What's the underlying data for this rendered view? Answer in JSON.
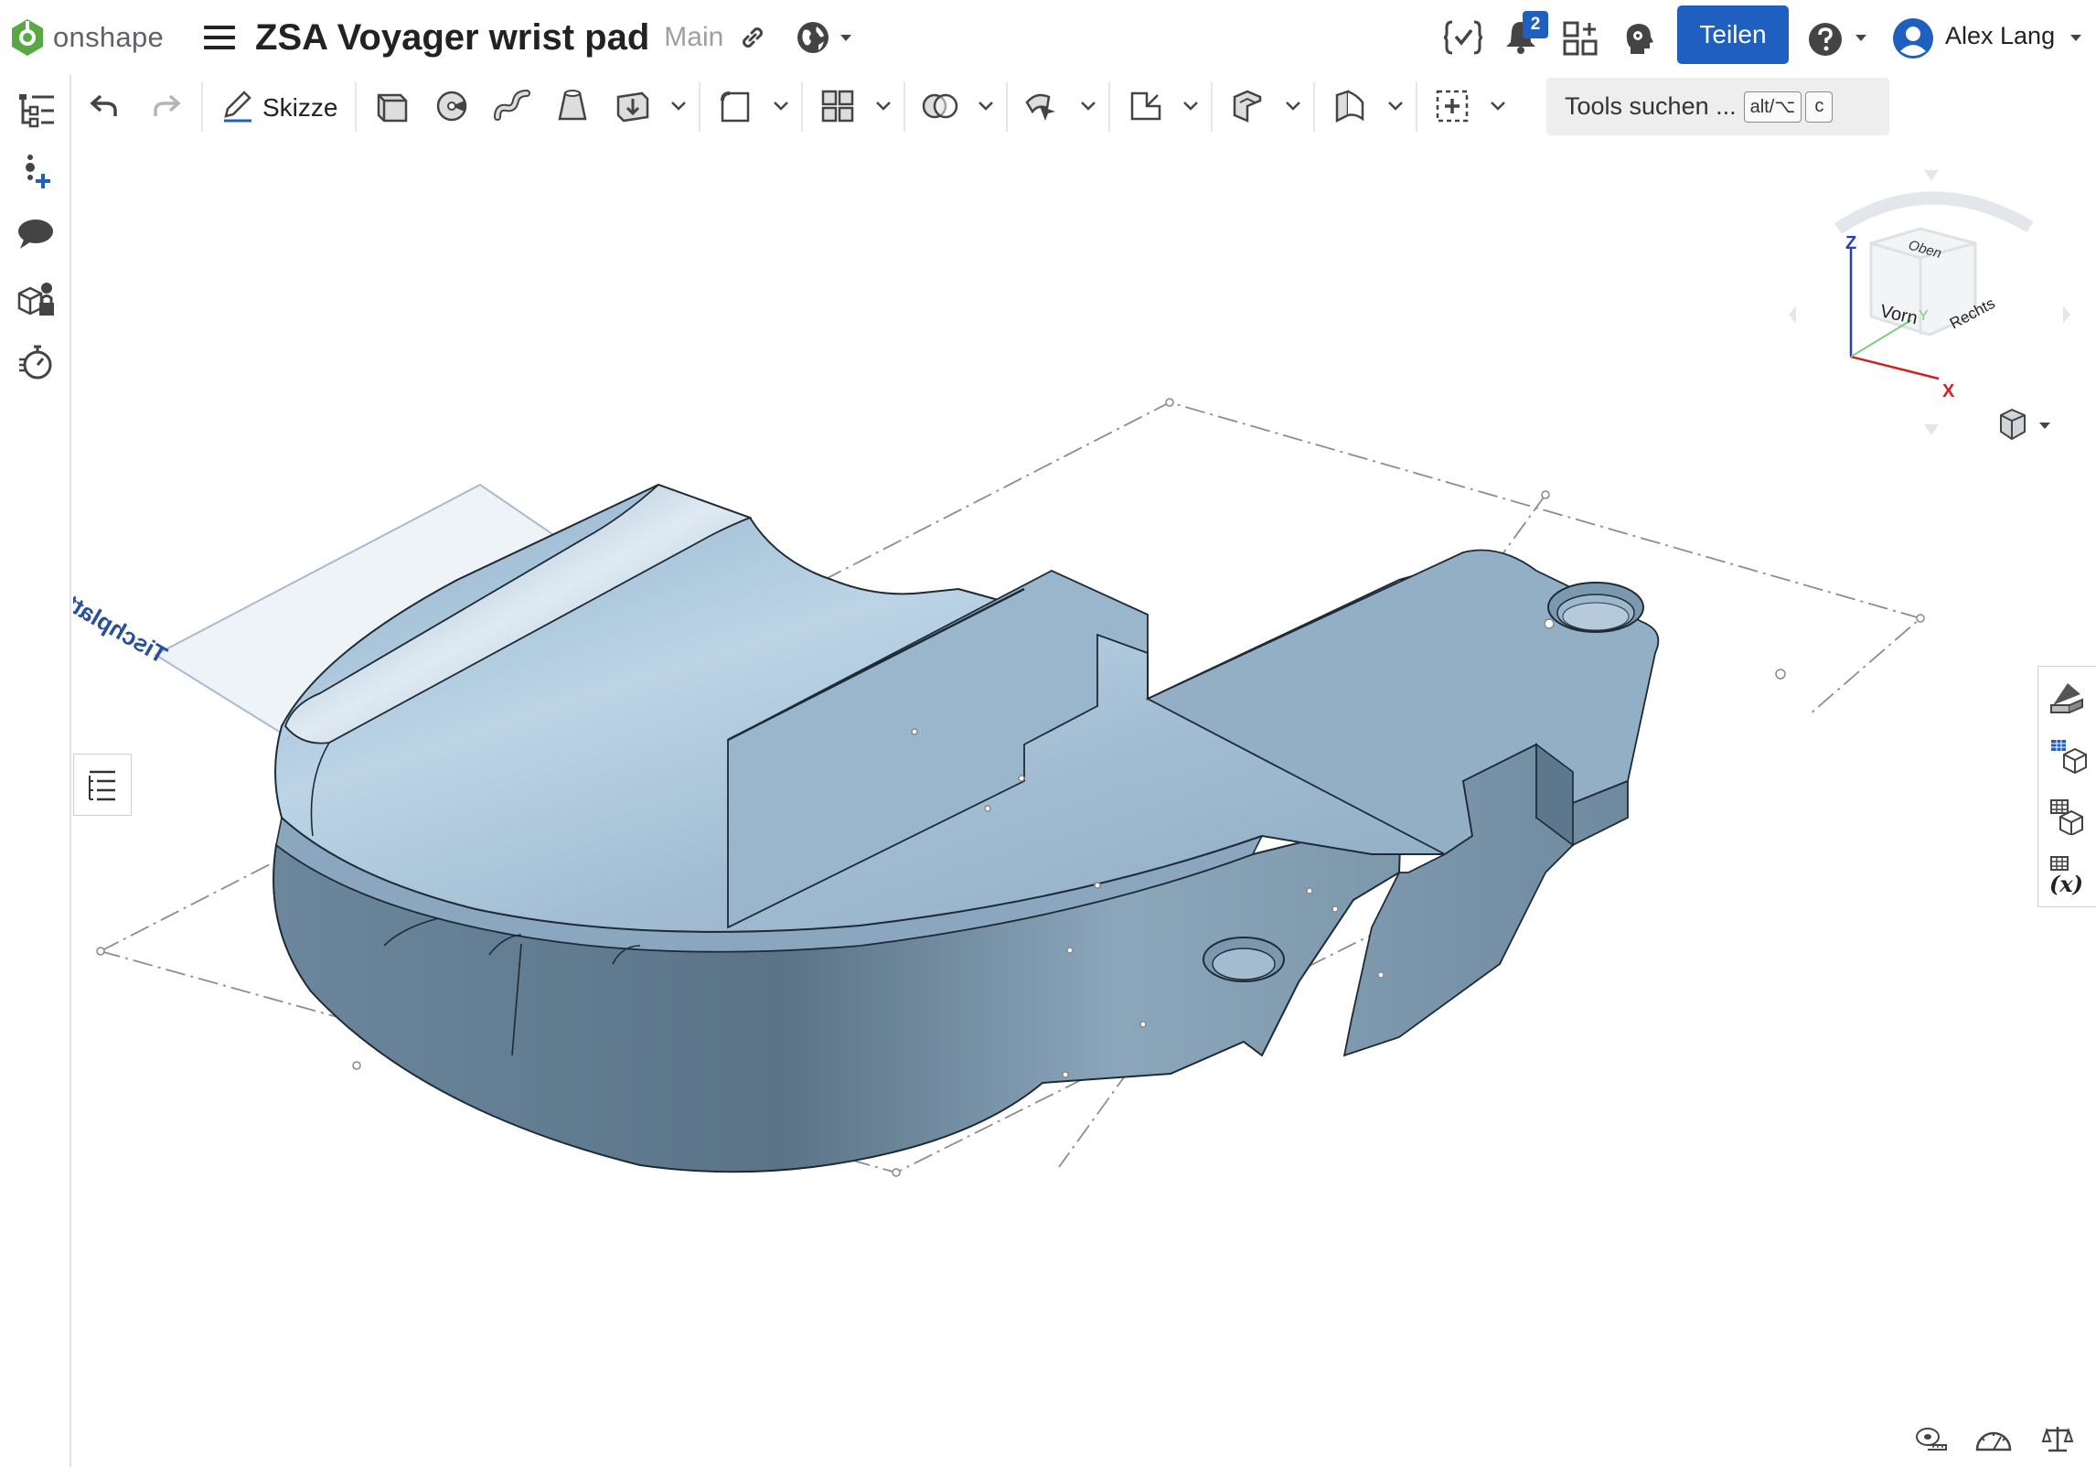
{
  "app": {
    "logo_text": "onshape"
  },
  "document": {
    "title": "ZSA Voyager wrist pad",
    "branch": "Main"
  },
  "header": {
    "notification_count": "2",
    "share_label": "Teilen",
    "user_name": "Alex Lang"
  },
  "toolbar": {
    "sketch_label": "Skizze",
    "search_placeholder": "Tools suchen ...",
    "search_shortcut_modifier": "alt/⌥",
    "search_shortcut_key": "c"
  },
  "viewcube": {
    "axis_z": "Z",
    "axis_x": "X",
    "axis_y": "Y",
    "face_top": "Oben",
    "face_front": "Vorn",
    "face_right": "Rechts"
  },
  "viewport": {
    "plane_label": "Tischplatte",
    "model_color": "#9bb4cb"
  },
  "colors": {
    "accent": "#1f5fbf",
    "badge": "#1f5fbf"
  }
}
